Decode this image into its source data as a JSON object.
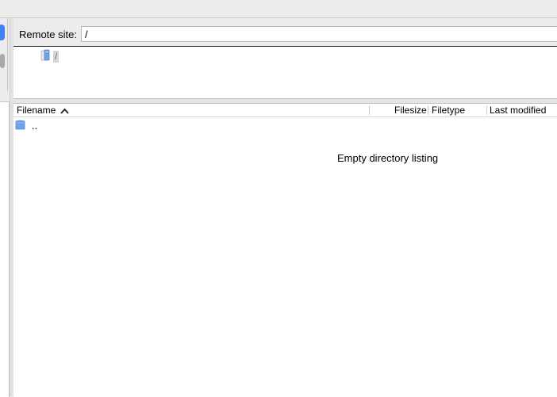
{
  "remote": {
    "label": "Remote site:",
    "path": "/"
  },
  "tree": {
    "root_label": "/"
  },
  "file_list": {
    "columns": [
      "Filename",
      "Filesize",
      "Filetype",
      "Last modified"
    ],
    "sort_column": "Filename",
    "sort_direction": "ascending",
    "rows": [
      {
        "name": "..",
        "icon": "folder-icon"
      }
    ],
    "empty_message": "Empty directory listing"
  },
  "colors": {
    "accent": "#3b82f7",
    "folder": "#6fa3e6"
  }
}
